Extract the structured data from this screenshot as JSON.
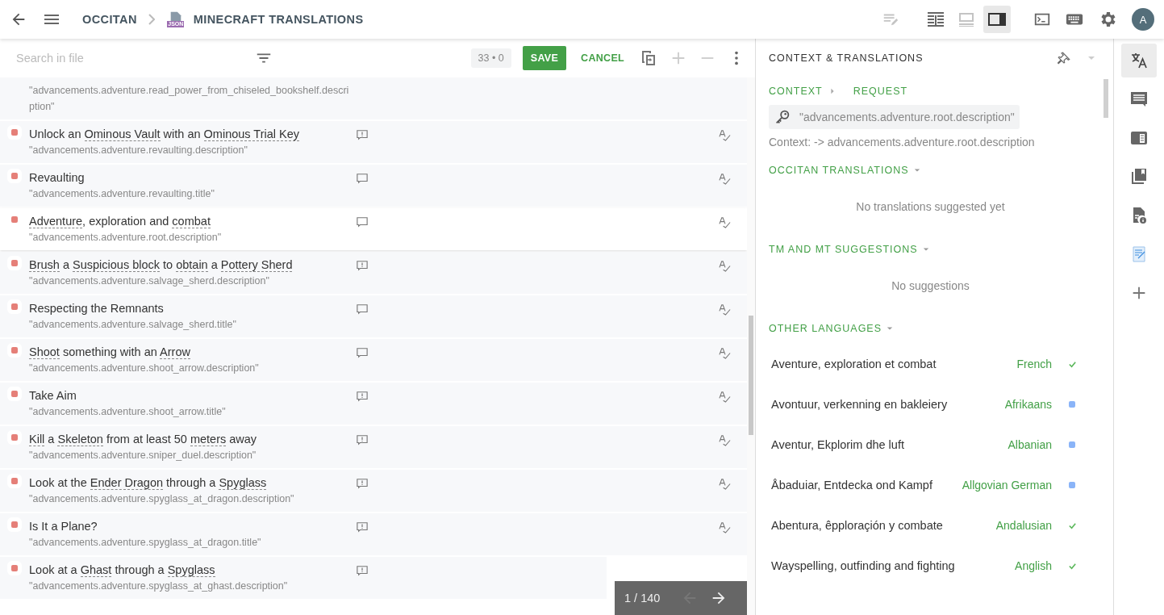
{
  "topbar": {
    "breadcrumb": [
      {
        "label": "OCCITAN"
      },
      {
        "label": "MINECRAFT TRANSLATIONS",
        "file_badge": "JSON"
      }
    ],
    "layout_modes": [
      {
        "kind": "columns",
        "selected": false
      },
      {
        "kind": "horizontal",
        "selected": false
      },
      {
        "kind": "sidebar",
        "selected": true
      }
    ],
    "avatar": "A"
  },
  "toolbar": {
    "search_placeholder": "Search in file",
    "counter": "33 • 0",
    "save": "SAVE",
    "cancel": "CANCEL"
  },
  "strings": [
    {
      "key": "\"advancements.adventure.read_power_from_chiseled_bookshelf.description\"",
      "selected": false
    },
    {
      "parts": [
        {
          "text": "Unlock an "
        },
        {
          "text": "Ominous Vault",
          "term": true
        },
        {
          "text": " with an "
        },
        {
          "text": "Ominous Trial Key",
          "term": true
        }
      ],
      "key": "\"advancements.adventure.revaulting.description\"",
      "selected": false,
      "kind": "flagged"
    },
    {
      "parts": [
        {
          "text": "Revaulting"
        }
      ],
      "key": "\"advancements.adventure.revaulting.title\"",
      "selected": false,
      "kind": "plain"
    },
    {
      "parts": [
        {
          "text": "Adventure",
          "term": true
        },
        {
          "text": ", exploration and "
        },
        {
          "text": "combat",
          "term": true
        }
      ],
      "key": "\"advancements.adventure.root.description\"",
      "selected": true,
      "kind": "plain"
    },
    {
      "parts": [
        {
          "text": "Brush",
          "term": true
        },
        {
          "text": " a "
        },
        {
          "text": "Suspicious block",
          "term": true
        },
        {
          "text": " to "
        },
        {
          "text": "obtain",
          "term": true
        },
        {
          "text": " a "
        },
        {
          "text": "Pottery Sherd",
          "term": true
        }
      ],
      "key": "\"advancements.adventure.salvage_sherd.description\"",
      "selected": false,
      "kind": "flagged"
    },
    {
      "parts": [
        {
          "text": "Respecting the Remnants"
        }
      ],
      "key": "\"advancements.adventure.salvage_sherd.title\"",
      "selected": false,
      "kind": "plain"
    },
    {
      "parts": [
        {
          "text": "Shoot",
          "term": true
        },
        {
          "text": " something with an "
        },
        {
          "text": "Arrow",
          "term": true
        }
      ],
      "key": "\"advancements.adventure.shoot_arrow.description\"",
      "selected": false,
      "kind": "plain"
    },
    {
      "parts": [
        {
          "text": "Take Aim"
        }
      ],
      "key": "\"advancements.adventure.shoot_arrow.title\"",
      "selected": false,
      "kind": "flagged"
    },
    {
      "parts": [
        {
          "text": "Kill",
          "term": true
        },
        {
          "text": " a "
        },
        {
          "text": "Skeleton",
          "term": true
        },
        {
          "text": " from at least 50 "
        },
        {
          "text": "meters",
          "term": true
        },
        {
          "text": " away"
        }
      ],
      "key": "\"advancements.adventure.sniper_duel.description\"",
      "selected": false,
      "kind": "flagged"
    },
    {
      "parts": [
        {
          "text": "Look at the "
        },
        {
          "text": "Ender Dragon",
          "term": true
        },
        {
          "text": " through a "
        },
        {
          "text": "Spyglass",
          "term": true
        }
      ],
      "key": "\"advancements.adventure.spyglass_at_dragon.description\"",
      "selected": false,
      "kind": "flagged"
    },
    {
      "parts": [
        {
          "text": "Is It a Plane?"
        }
      ],
      "key": "\"advancements.adventure.spyglass_at_dragon.title\"",
      "selected": false,
      "kind": "flagged"
    },
    {
      "parts": [
        {
          "text": "Look at a "
        },
        {
          "text": "Ghast",
          "term": true
        },
        {
          "text": " through a "
        },
        {
          "text": "Spyglass",
          "term": true
        }
      ],
      "key": "\"advancements.adventure.spyglass_at_ghast.description\"",
      "selected": false,
      "kind": "flagged"
    }
  ],
  "pager": {
    "position": "1 / 140"
  },
  "context_panel": {
    "title": "CONTEXT & TRANSLATIONS",
    "tabs": [
      {
        "label": "CONTEXT"
      },
      {
        "label": "REQUEST"
      }
    ],
    "key": "\"advancements.adventure.root.description\"",
    "context_note": "Context: -> advancements.adventure.root.description",
    "sections": [
      {
        "title": "OCCITAN TRANSLATIONS",
        "empty": "No translations suggested yet"
      },
      {
        "title": "TM AND MT SUGGESTIONS",
        "empty": "No suggestions"
      },
      {
        "title": "OTHER LANGUAGES"
      }
    ],
    "other_languages": [
      {
        "text": "Aventure, exploration et combat",
        "language": "French",
        "approved": true
      },
      {
        "text": "Avontuur, verkenning en bakleiery",
        "language": "Afrikaans",
        "approved": false
      },
      {
        "text": "Aventur, Ekplorim dhe luft",
        "language": "Albanian",
        "approved": false
      },
      {
        "text": "Åbaduiar, Entdecka ond Kampf",
        "language": "Allgovian German",
        "approved": false
      },
      {
        "text": "Abentura, êpploraçión y combate",
        "language": "Andalusian",
        "approved": true
      },
      {
        "text": "Wayspelling, outfinding and fighting",
        "language": "Anglish",
        "approved": true
      }
    ]
  },
  "rail": [
    {
      "kind": "translate",
      "selected": true
    },
    {
      "kind": "comments",
      "selected": false
    },
    {
      "kind": "panel",
      "selected": false
    },
    {
      "kind": "bookmarks",
      "selected": false
    },
    {
      "kind": "file-info",
      "selected": false
    },
    {
      "kind": "notes",
      "selected": false
    },
    {
      "kind": "add",
      "selected": false
    }
  ]
}
